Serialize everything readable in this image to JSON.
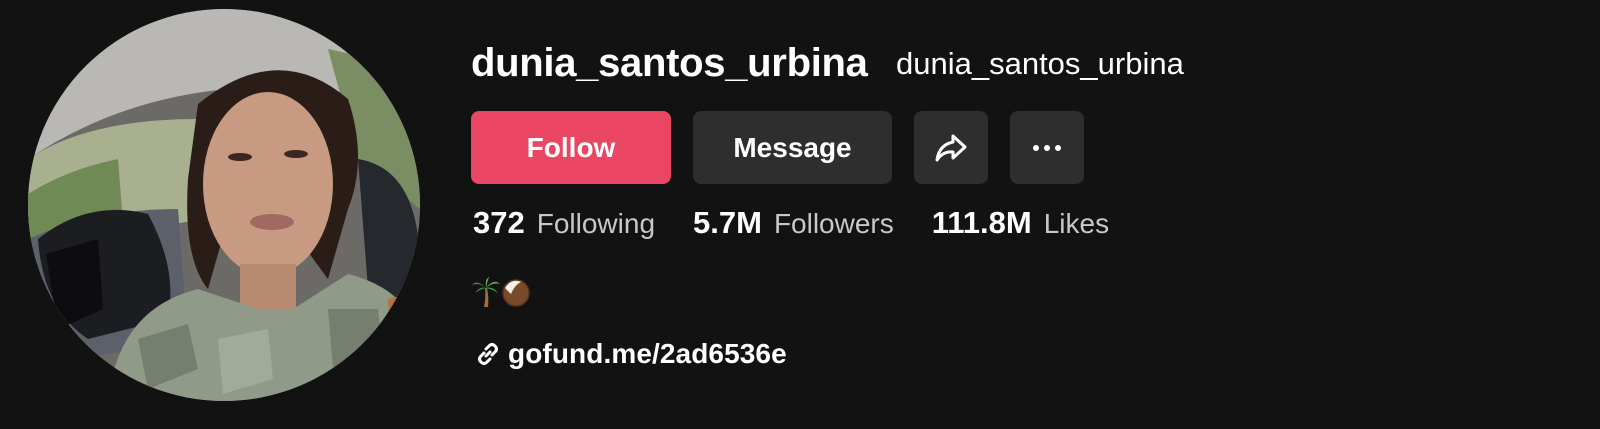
{
  "profile": {
    "username": "dunia_santos_urbina",
    "nickname": "dunia_santos_urbina",
    "avatar_icon": "profile-photo",
    "bio_icons": [
      "palm-tree-icon",
      "coconut-icon"
    ],
    "link_text": "gofund.me/2ad6536e"
  },
  "actions": {
    "follow_label": "Follow",
    "message_label": "Message",
    "share_icon": "share-arrow-icon",
    "more_icon": "more-dots-icon"
  },
  "stats": {
    "following_value": "372",
    "following_label": "Following",
    "followers_value": "5.7M",
    "followers_label": "Followers",
    "likes_value": "111.8M",
    "likes_label": "Likes"
  },
  "colors": {
    "background": "#121212",
    "follow_accent": "#ea4562",
    "secondary_button": "#2e2e2e",
    "text_primary": "#ffffff",
    "text_secondary": "#c8c8c8"
  }
}
